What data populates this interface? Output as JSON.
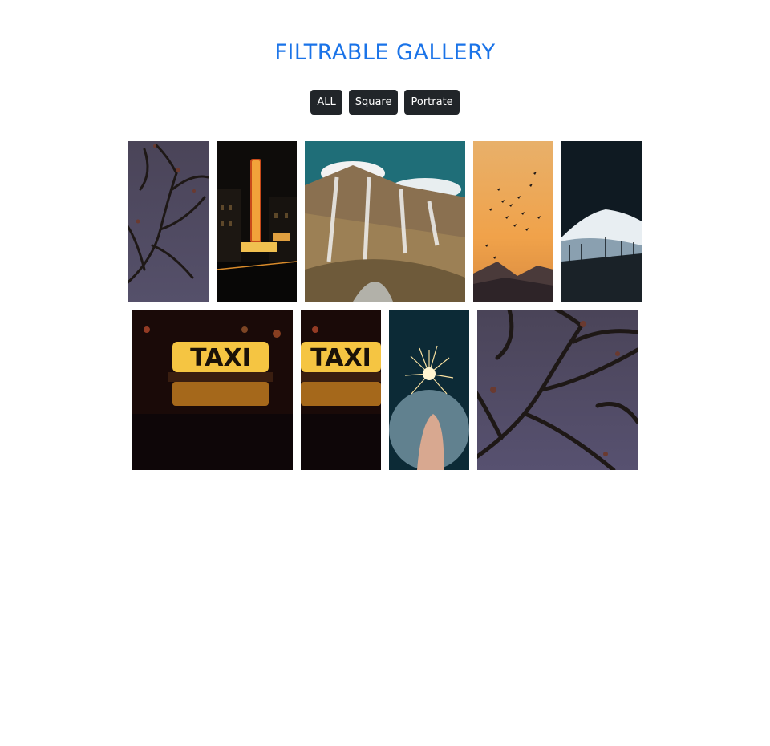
{
  "header": {
    "title": "FILTRABLE GALLERY",
    "title_color": "#1a73e8"
  },
  "filters": [
    {
      "label": "ALL"
    },
    {
      "label": "Square"
    },
    {
      "label": "Portrate"
    }
  ],
  "gallery": {
    "rows": [
      [
        {
          "subject": "tree-branches-dusk",
          "shape": "portrait"
        },
        {
          "subject": "chicago-theater-sign",
          "shape": "portrait"
        },
        {
          "subject": "mountain-waterfalls",
          "shape": "square"
        },
        {
          "subject": "birds-sunset-sky",
          "shape": "portrait"
        },
        {
          "subject": "snowy-mountain-peak",
          "shape": "portrait"
        }
      ],
      [
        {
          "subject": "taxi-sign-night",
          "shape": "square"
        },
        {
          "subject": "taxi-sign-night",
          "shape": "portrait"
        },
        {
          "subject": "sparkler-in-hand",
          "shape": "portrait"
        },
        {
          "subject": "tree-branches-dusk",
          "shape": "square"
        }
      ]
    ]
  }
}
